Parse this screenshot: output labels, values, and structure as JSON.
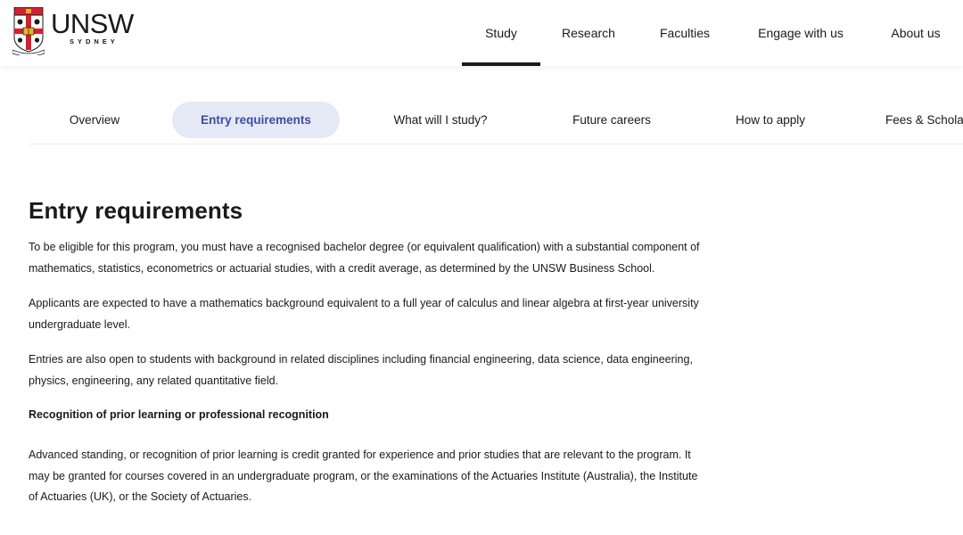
{
  "brand": {
    "name": "UNSW",
    "city": "SYDNEY"
  },
  "top_nav": {
    "items": [
      "Study",
      "Research",
      "Faculties",
      "Engage with us",
      "About us"
    ],
    "active": "Study"
  },
  "sub_tabs": {
    "items": [
      "Overview",
      "Entry requirements",
      "What will I study?",
      "Future careers",
      "How to apply",
      "Fees & Schola"
    ],
    "active": "Entry requirements"
  },
  "main": {
    "title": "Entry requirements",
    "paragraphs": [
      "To be eligible for this program, you must have a recognised bachelor degree (or equivalent qualification) with a substantial component of mathematics, statistics, econometrics or actuarial studies, with a credit average, as determined by the UNSW Business School.",
      "Applicants are expected to have a mathematics background equivalent to a full year of calculus and linear algebra at first-year university undergraduate level.",
      "Entries are also open to students with background in related disciplines including financial engineering, data science, data engineering, physics, engineering, any related quantitative field."
    ],
    "subheading": "Recognition of prior learning or professional recognition",
    "rpl_paragraph": "Advanced standing, or recognition of prior learning is credit granted for experience and prior studies that are relevant to the program. It may be granted for courses covered in an undergraduate program, or the examinations of the Actuaries Institute (Australia), the Institute of Actuaries (UK), or the Society of Actuaries."
  },
  "colors": {
    "active_tab_bg": "#e5e8f5",
    "active_tab_text": "#3c4e9e",
    "crest_red": "#d3202f",
    "crest_gold": "#e9b22c",
    "text": "#1a1a1a"
  },
  "icons": [
    "unsw-crest-icon"
  ]
}
